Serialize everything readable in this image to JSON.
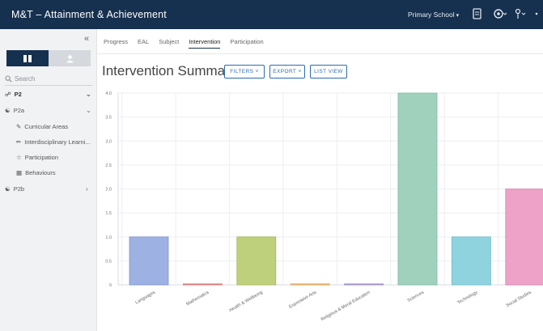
{
  "app": {
    "title": "M&T – Attainment & Achievement"
  },
  "topbar": {
    "school": "Primary School",
    "icons": [
      "document-icon",
      "settings-icon",
      "user-icon",
      "more-icon"
    ]
  },
  "sidebar": {
    "collapse_glyph": "«",
    "search_placeholder": "Search",
    "tree": [
      {
        "label": "P2",
        "icon": "class-icon",
        "expanded": true
      },
      {
        "label": "P2a",
        "icon": "group-icon",
        "expanded": true
      },
      {
        "label": "Curricular Areas",
        "icon": "edit-icon"
      },
      {
        "label": "Interdisciplinary Learni...",
        "icon": "pencil-icon"
      },
      {
        "label": "Participation",
        "icon": "star-icon"
      },
      {
        "label": "Behaviours",
        "icon": "grid-icon"
      },
      {
        "label": "P2b",
        "icon": "group-icon",
        "expanded": false
      }
    ]
  },
  "tabs": [
    "Progress",
    "EAL",
    "Subject",
    "Intervention",
    "Participation"
  ],
  "active_tab": "Intervention",
  "page": {
    "title": "Intervention Summary",
    "filters_label": "FILTERS",
    "export_label": "EXPORT",
    "list_view_label": "LIST VIEW"
  },
  "chart_data": {
    "type": "bar",
    "categories": [
      "Languages",
      "Mathematics",
      "Health & Wellbeing",
      "Expressive Arts",
      "Religious & Moral Education",
      "Sciences",
      "Technology",
      "Social Studies"
    ],
    "values": [
      1,
      0,
      1,
      0,
      0,
      4,
      1,
      2
    ],
    "colors": [
      "#9db1e3",
      "#e99a9a",
      "#bfd07d",
      "#f0c080",
      "#b8a8d8",
      "#9fd1bd",
      "#8fd3df",
      "#eea2c8"
    ],
    "edge_colors": [
      "#7f95cc",
      "#d97070",
      "#a3b65c",
      "#e0a050",
      "#9c88c4",
      "#7dbaa3",
      "#6cbccc",
      "#dd80b0"
    ],
    "ylim": [
      0,
      4
    ],
    "yticks": [
      "0",
      "0.5",
      "1.0",
      "1.5",
      "2.0",
      "2.5",
      "3.0",
      "3.5",
      "4.0"
    ],
    "grid": true
  }
}
